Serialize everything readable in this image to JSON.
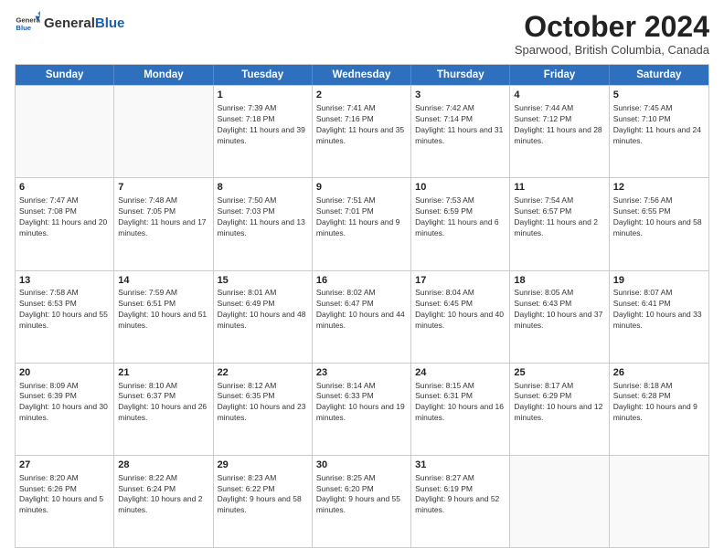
{
  "logo": {
    "general": "General",
    "blue": "Blue"
  },
  "header": {
    "month": "October 2024",
    "location": "Sparwood, British Columbia, Canada"
  },
  "weekdays": [
    "Sunday",
    "Monday",
    "Tuesday",
    "Wednesday",
    "Thursday",
    "Friday",
    "Saturday"
  ],
  "weeks": [
    [
      {
        "day": "",
        "sunrise": "",
        "sunset": "",
        "daylight": ""
      },
      {
        "day": "",
        "sunrise": "",
        "sunset": "",
        "daylight": ""
      },
      {
        "day": "1",
        "sunrise": "Sunrise: 7:39 AM",
        "sunset": "Sunset: 7:18 PM",
        "daylight": "Daylight: 11 hours and 39 minutes."
      },
      {
        "day": "2",
        "sunrise": "Sunrise: 7:41 AM",
        "sunset": "Sunset: 7:16 PM",
        "daylight": "Daylight: 11 hours and 35 minutes."
      },
      {
        "day": "3",
        "sunrise": "Sunrise: 7:42 AM",
        "sunset": "Sunset: 7:14 PM",
        "daylight": "Daylight: 11 hours and 31 minutes."
      },
      {
        "day": "4",
        "sunrise": "Sunrise: 7:44 AM",
        "sunset": "Sunset: 7:12 PM",
        "daylight": "Daylight: 11 hours and 28 minutes."
      },
      {
        "day": "5",
        "sunrise": "Sunrise: 7:45 AM",
        "sunset": "Sunset: 7:10 PM",
        "daylight": "Daylight: 11 hours and 24 minutes."
      }
    ],
    [
      {
        "day": "6",
        "sunrise": "Sunrise: 7:47 AM",
        "sunset": "Sunset: 7:08 PM",
        "daylight": "Daylight: 11 hours and 20 minutes."
      },
      {
        "day": "7",
        "sunrise": "Sunrise: 7:48 AM",
        "sunset": "Sunset: 7:05 PM",
        "daylight": "Daylight: 11 hours and 17 minutes."
      },
      {
        "day": "8",
        "sunrise": "Sunrise: 7:50 AM",
        "sunset": "Sunset: 7:03 PM",
        "daylight": "Daylight: 11 hours and 13 minutes."
      },
      {
        "day": "9",
        "sunrise": "Sunrise: 7:51 AM",
        "sunset": "Sunset: 7:01 PM",
        "daylight": "Daylight: 11 hours and 9 minutes."
      },
      {
        "day": "10",
        "sunrise": "Sunrise: 7:53 AM",
        "sunset": "Sunset: 6:59 PM",
        "daylight": "Daylight: 11 hours and 6 minutes."
      },
      {
        "day": "11",
        "sunrise": "Sunrise: 7:54 AM",
        "sunset": "Sunset: 6:57 PM",
        "daylight": "Daylight: 11 hours and 2 minutes."
      },
      {
        "day": "12",
        "sunrise": "Sunrise: 7:56 AM",
        "sunset": "Sunset: 6:55 PM",
        "daylight": "Daylight: 10 hours and 58 minutes."
      }
    ],
    [
      {
        "day": "13",
        "sunrise": "Sunrise: 7:58 AM",
        "sunset": "Sunset: 6:53 PM",
        "daylight": "Daylight: 10 hours and 55 minutes."
      },
      {
        "day": "14",
        "sunrise": "Sunrise: 7:59 AM",
        "sunset": "Sunset: 6:51 PM",
        "daylight": "Daylight: 10 hours and 51 minutes."
      },
      {
        "day": "15",
        "sunrise": "Sunrise: 8:01 AM",
        "sunset": "Sunset: 6:49 PM",
        "daylight": "Daylight: 10 hours and 48 minutes."
      },
      {
        "day": "16",
        "sunrise": "Sunrise: 8:02 AM",
        "sunset": "Sunset: 6:47 PM",
        "daylight": "Daylight: 10 hours and 44 minutes."
      },
      {
        "day": "17",
        "sunrise": "Sunrise: 8:04 AM",
        "sunset": "Sunset: 6:45 PM",
        "daylight": "Daylight: 10 hours and 40 minutes."
      },
      {
        "day": "18",
        "sunrise": "Sunrise: 8:05 AM",
        "sunset": "Sunset: 6:43 PM",
        "daylight": "Daylight: 10 hours and 37 minutes."
      },
      {
        "day": "19",
        "sunrise": "Sunrise: 8:07 AM",
        "sunset": "Sunset: 6:41 PM",
        "daylight": "Daylight: 10 hours and 33 minutes."
      }
    ],
    [
      {
        "day": "20",
        "sunrise": "Sunrise: 8:09 AM",
        "sunset": "Sunset: 6:39 PM",
        "daylight": "Daylight: 10 hours and 30 minutes."
      },
      {
        "day": "21",
        "sunrise": "Sunrise: 8:10 AM",
        "sunset": "Sunset: 6:37 PM",
        "daylight": "Daylight: 10 hours and 26 minutes."
      },
      {
        "day": "22",
        "sunrise": "Sunrise: 8:12 AM",
        "sunset": "Sunset: 6:35 PM",
        "daylight": "Daylight: 10 hours and 23 minutes."
      },
      {
        "day": "23",
        "sunrise": "Sunrise: 8:14 AM",
        "sunset": "Sunset: 6:33 PM",
        "daylight": "Daylight: 10 hours and 19 minutes."
      },
      {
        "day": "24",
        "sunrise": "Sunrise: 8:15 AM",
        "sunset": "Sunset: 6:31 PM",
        "daylight": "Daylight: 10 hours and 16 minutes."
      },
      {
        "day": "25",
        "sunrise": "Sunrise: 8:17 AM",
        "sunset": "Sunset: 6:29 PM",
        "daylight": "Daylight: 10 hours and 12 minutes."
      },
      {
        "day": "26",
        "sunrise": "Sunrise: 8:18 AM",
        "sunset": "Sunset: 6:28 PM",
        "daylight": "Daylight: 10 hours and 9 minutes."
      }
    ],
    [
      {
        "day": "27",
        "sunrise": "Sunrise: 8:20 AM",
        "sunset": "Sunset: 6:26 PM",
        "daylight": "Daylight: 10 hours and 5 minutes."
      },
      {
        "day": "28",
        "sunrise": "Sunrise: 8:22 AM",
        "sunset": "Sunset: 6:24 PM",
        "daylight": "Daylight: 10 hours and 2 minutes."
      },
      {
        "day": "29",
        "sunrise": "Sunrise: 8:23 AM",
        "sunset": "Sunset: 6:22 PM",
        "daylight": "Daylight: 9 hours and 58 minutes."
      },
      {
        "day": "30",
        "sunrise": "Sunrise: 8:25 AM",
        "sunset": "Sunset: 6:20 PM",
        "daylight": "Daylight: 9 hours and 55 minutes."
      },
      {
        "day": "31",
        "sunrise": "Sunrise: 8:27 AM",
        "sunset": "Sunset: 6:19 PM",
        "daylight": "Daylight: 9 hours and 52 minutes."
      },
      {
        "day": "",
        "sunrise": "",
        "sunset": "",
        "daylight": ""
      },
      {
        "day": "",
        "sunrise": "",
        "sunset": "",
        "daylight": ""
      }
    ]
  ]
}
